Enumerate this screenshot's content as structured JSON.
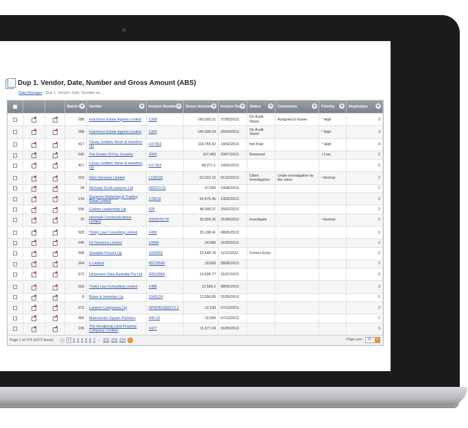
{
  "page": {
    "title": "Dup 1. Vendor, Date, Number and Gross Amount (ABS)",
    "breadcrumb_root": "Data Manager",
    "breadcrumb_current": "Dup 1. Vendor, Date, Number an..."
  },
  "grid": {
    "headers": [
      "",
      "",
      "",
      "Batch ID",
      "Vendor",
      "Invoice Number",
      "Gross Amount",
      "Invoice Date",
      "Status",
      "Comments",
      "Priority",
      "Duplicates"
    ],
    "rows": [
      {
        "batch": "288",
        "vendor": "Hutchison Estate Agents Limited",
        "invoice": "1308",
        "gross": "143,005.21",
        "date": "27/05/2013",
        "status": "On Audit Sheet",
        "comments": "Assigned to Karen",
        "priority": "High",
        "prio_icon": "^",
        "dups": "3"
      },
      {
        "batch": "288",
        "vendor": "Hutchison Estate Agents Limited",
        "invoice": "1308",
        "gross": "140,599.24",
        "date": "26/04/2013",
        "status": "On Audit Sheet",
        "comments": "",
        "priority": "High",
        "prio_icon": "^",
        "dups": "3"
      },
      {
        "batch": "417",
        "vendor": "Cleary Gottlieb Steen & Hamilton Llp",
        "invoice": "H17363",
        "gross": "118,765.32",
        "date": "14/02/2013",
        "status": "Not Paid",
        "comments": "",
        "priority": "High",
        "prio_icon": "^",
        "dups": "4"
      },
      {
        "batch": "542",
        "vendor": "The Estate Of Fay Josephs",
        "invoice": "3008",
        "gross": "107,403",
        "date": "29/07/2013",
        "status": "Reversed",
        "comments": "",
        "priority": "Low",
        "prio_icon": "v",
        "dups": "2"
      },
      {
        "batch": "417",
        "vendor": "Cleary Gottlieb Steen & Hamilton Llp",
        "invoice": "H17363",
        "gross": "98,971.1",
        "date": "14/02/2013",
        "status": "",
        "comments": "",
        "priority": "",
        "prio_icon": "",
        "dups": "2"
      },
      {
        "batch": "163",
        "vendor": "Gbm Services Limited",
        "invoice": "L108130",
        "gross": "63,322.16",
        "date": "01/10/2013",
        "status": "Client Investigation",
        "comments": "Under investigation by the client",
        "priority": "Normal",
        "prio_icon": "•",
        "dups": "2"
      },
      {
        "batch": "34",
        "vendor": "Nicholas Scott Lawyers Ltd",
        "invoice": "082013-01",
        "gross": "57,600",
        "date": "14/08/2013",
        "status": "",
        "comments": "",
        "priority": "",
        "prio_icon": "",
        "dups": "2"
      },
      {
        "batch": "124",
        "vendor": "Gazprom Marketing & Trading Retail Limited",
        "invoice": "178219",
        "gross": "52,475.46",
        "date": "13/02/2013",
        "status": "",
        "comments": "",
        "priority": "",
        "prio_icon": "",
        "dups": "2"
      },
      {
        "batch": "596",
        "vendor": "Carbon Leadership Llp",
        "invoice": "625",
        "gross": "48,090.37",
        "date": "25/02/2013",
        "status": "",
        "comments": "",
        "priority": "",
        "prio_icon": "",
        "dups": "2"
      },
      {
        "batch": "75",
        "vendor": "Interoute Communications Limited",
        "invoice": "2000078178",
        "gross": "30,959.26",
        "date": "31/08/2013",
        "status": "Investigate",
        "comments": "",
        "priority": "Normal",
        "prio_icon": "•",
        "dups": "2"
      },
      {
        "batch": "503",
        "vendor": "Trinity Law Consulting Limited",
        "invoice": "1488",
        "gross": "25,138.41",
        "date": "08/05/2013",
        "status": "",
        "comments": "",
        "priority": "",
        "prio_icon": "",
        "dups": "2"
      },
      {
        "batch": "646",
        "vendor": "Fd Solutions Limited",
        "invoice": "10944",
        "gross": "24,696",
        "date": "31/03/2013",
        "status": "",
        "comments": "",
        "priority": "",
        "prio_icon": "",
        "dups": "2"
      },
      {
        "batch": "568",
        "vendor": "Goodwin Procter Llp",
        "invoice": "1028552",
        "gross": "23,546.78",
        "date": "11/12/2012",
        "status": "Correct Entry",
        "comments": "",
        "priority": "",
        "prio_icon": "",
        "dups": "2"
      },
      {
        "batch": "304",
        "vendor": "Ir Limited",
        "invoice": "45278500",
        "gross": "18,000",
        "date": "08/08/2013",
        "status": "",
        "comments": "",
        "priority": "",
        "prio_icon": "",
        "dups": "2"
      },
      {
        "batch": "572",
        "vendor": "Dimension Data Australia Pty Ltd",
        "invoice": "90510950",
        "gross": "13,696.77",
        "date": "31/07/2013",
        "status": "",
        "comments": "",
        "priority": "",
        "prio_icon": "",
        "dups": "2"
      },
      {
        "batch": "503",
        "vendor": "Trinity Law Consulting Limited",
        "invoice": "1488",
        "gross": "12,569.2",
        "date": "08/05/2013",
        "status": "",
        "comments": "",
        "priority": "",
        "prio_icon": "",
        "dups": "3"
      },
      {
        "batch": "8",
        "vendor": "Baker & Hostetler Llp",
        "invoice": "1568124",
        "gross": "12,556.89",
        "date": "31/05/2013",
        "status": "",
        "comments": "",
        "priority": "",
        "prio_icon": "",
        "dups": "2"
      },
      {
        "batch": "372",
        "vendor": "Lockton Companies Llp",
        "invoice": "SPRDR1200273-1",
        "gross": "12,190",
        "date": "07/12/2012",
        "status": "",
        "comments": "",
        "priority": "",
        "prio_icon": "",
        "dups": "2"
      },
      {
        "batch": "380",
        "vendor": "Manchester Square Partners",
        "invoice": "446-13",
        "gross": "12,000",
        "date": "07/12/2012",
        "status": "",
        "comments": "",
        "priority": "",
        "prio_icon": "",
        "dups": "2"
      },
      {
        "batch": "105",
        "vendor": "The Hongkong Land Property Company, Limited",
        "invoice": "1427",
        "gross": "11,577.34",
        "date": "01/05/2013",
        "status": "",
        "comments": "",
        "priority": "",
        "prio_icon": "",
        "dups": "3"
      }
    ]
  },
  "pager": {
    "summary": "Page 1 of 274 (5473 items)",
    "current": "1",
    "pages": [
      "2",
      "3",
      "4",
      "5",
      "6",
      "7"
    ],
    "ellipsis": "...",
    "last_pages": [
      "272",
      "273",
      "274"
    ],
    "page_size_label": "Page size:",
    "page_size": "20"
  },
  "colors": {
    "accent": "#f08a24",
    "link": "#2a55a8",
    "header": "#8a9099",
    "high": "#c0392b",
    "normal": "#3a8a3a"
  }
}
